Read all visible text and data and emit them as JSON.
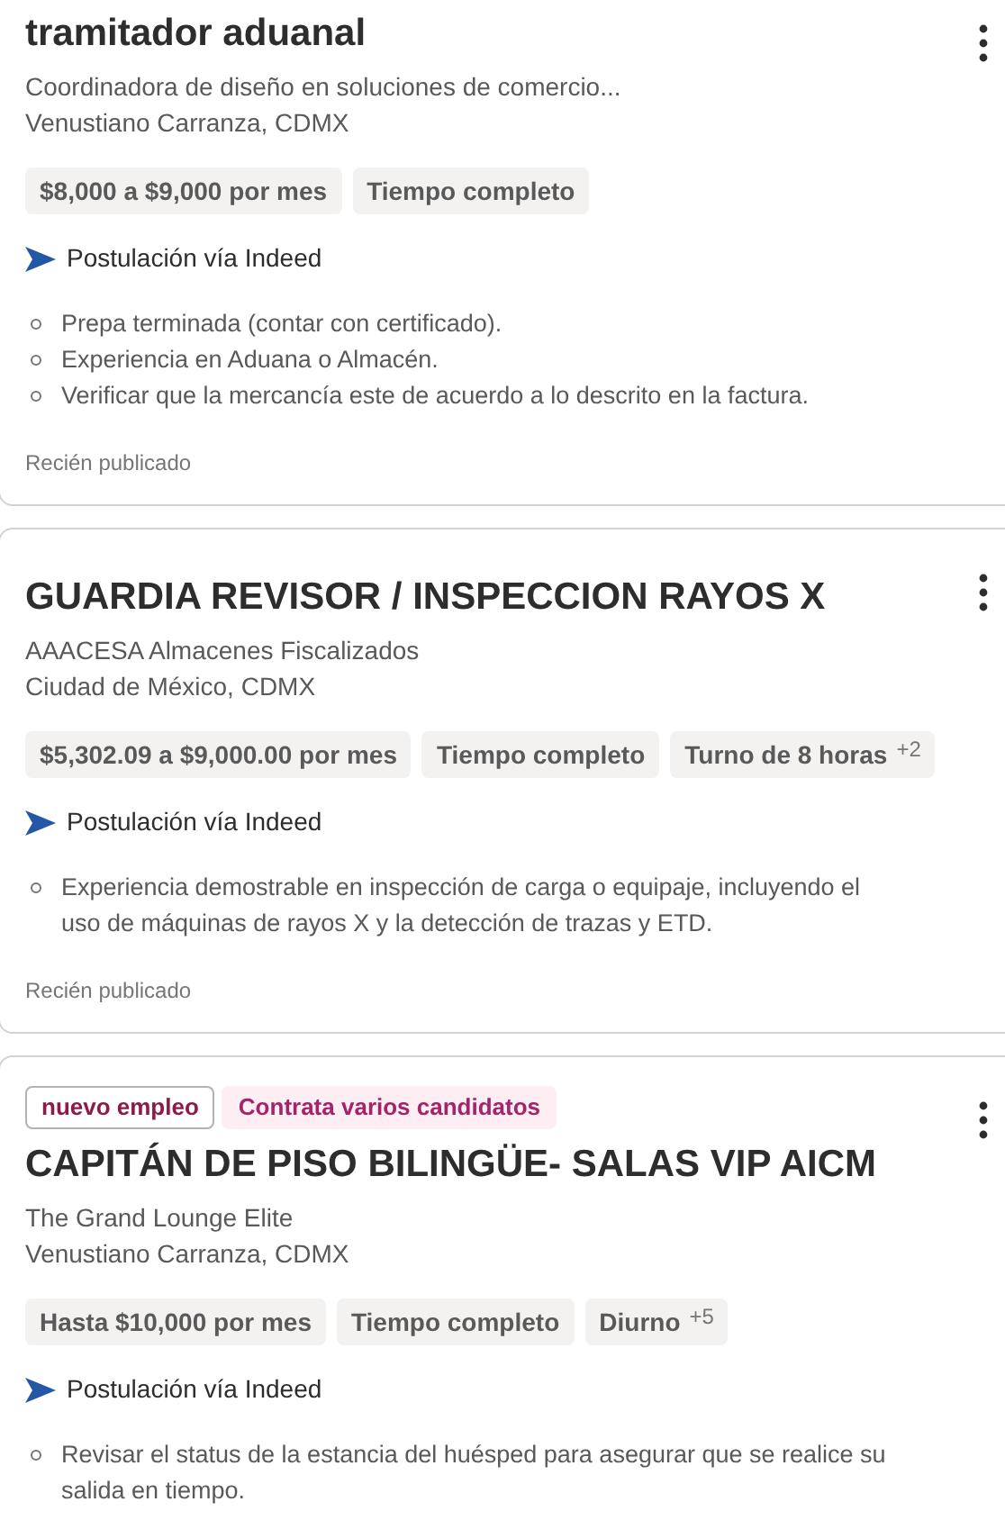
{
  "jobs": [
    {
      "title": "tramitador aduanal",
      "company": "Coordinadora de diseño en soluciones de comercio...",
      "location": "Venustiano Carranza, CDMX",
      "tags": [
        {
          "label": "$8,000 a $9,000 por mes"
        },
        {
          "label": "Tiempo completo"
        }
      ],
      "apply": "Postulación vía Indeed",
      "bullets": [
        "Prepa terminada (contar con certificado).",
        "Experiencia en Aduana o Almacén.",
        "Verificar que la mercancía este de acuerdo a lo descrito en la factura."
      ],
      "posted": "Recién publicado"
    },
    {
      "title": "GUARDIA REVISOR / INSPECCION RAYOS X",
      "company": "AAACESA Almacenes Fiscalizados",
      "location": "Ciudad de México, CDMX",
      "tags": [
        {
          "label": "$5,302.09 a $9,000.00 por mes"
        },
        {
          "label": "Tiempo completo"
        },
        {
          "label": "Turno de 8 horas",
          "more": "+2"
        }
      ],
      "apply": "Postulación vía Indeed",
      "bullets": [
        "Experiencia demostrable en inspección de carga o equipaje, incluyendo el uso de máquinas de rayos X y la detección de trazas y ETD."
      ],
      "posted": "Recién publicado"
    },
    {
      "badges": [
        {
          "label": "nuevo empleo",
          "kind": "outline"
        },
        {
          "label": "Contrata varios candidatos",
          "kind": "filled"
        }
      ],
      "title": "CAPITÁN DE PISO BILINGÜE- SALAS VIP AICM",
      "company": "The Grand Lounge Elite",
      "location": "Venustiano Carranza, CDMX",
      "tags": [
        {
          "label": "Hasta $10,000 por mes"
        },
        {
          "label": "Tiempo completo"
        },
        {
          "label": "Diurno",
          "more": "+5"
        }
      ],
      "apply": "Postulación vía Indeed",
      "bullets": [
        "Revisar el status de la estancia del huésped para asegurar que se realice su salida en tiempo."
      ]
    }
  ]
}
